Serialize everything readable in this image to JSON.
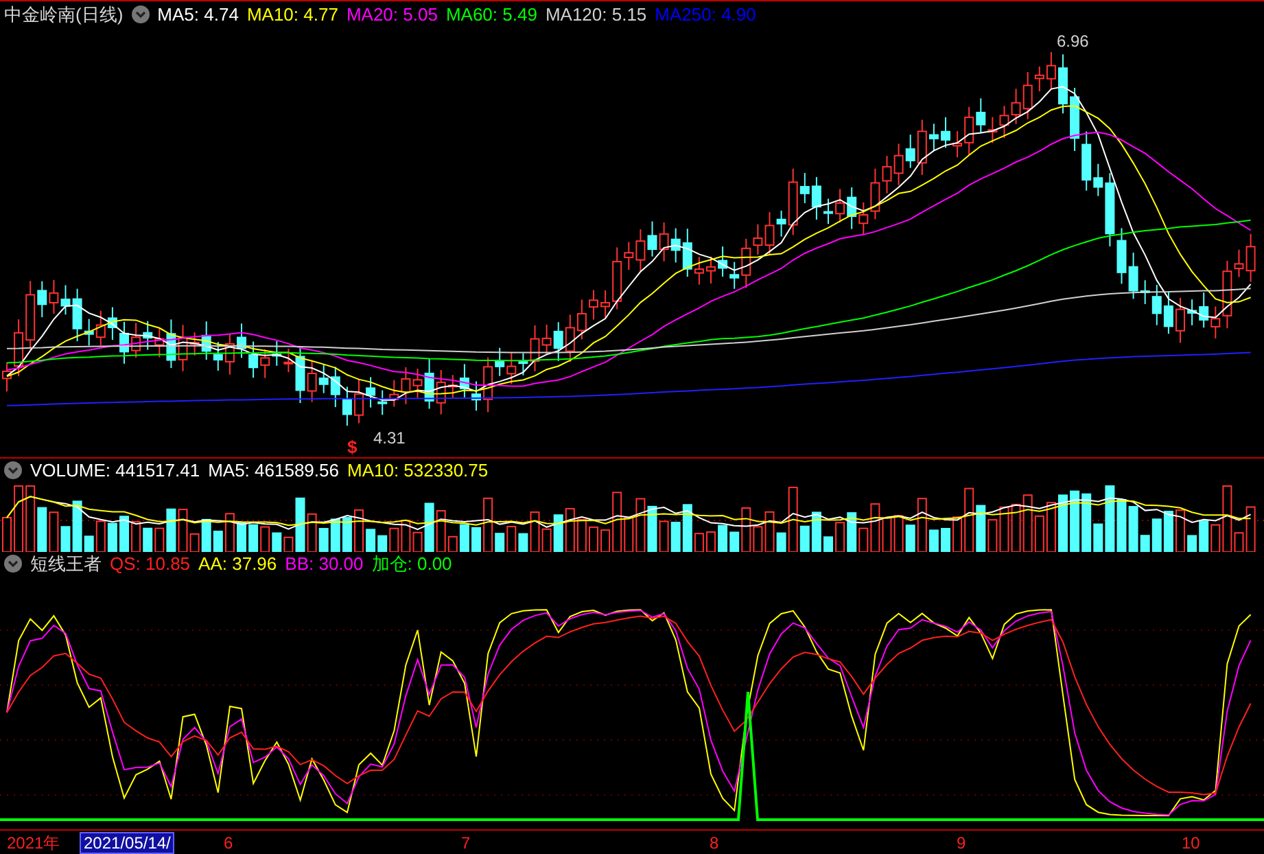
{
  "title": "中金岭南(日线)",
  "ma_legend": [
    {
      "label": "MA5: 4.74",
      "color": "#ffffff"
    },
    {
      "label": "MA10: 4.77",
      "color": "#ffff00"
    },
    {
      "label": "MA20: 5.05",
      "color": "#ff00ff"
    },
    {
      "label": "MA60: 5.49",
      "color": "#00ff00"
    },
    {
      "label": "MA120: 5.15",
      "color": "#d0d0d0"
    },
    {
      "label": "MA250: 4.90",
      "color": "#0000ff"
    }
  ],
  "price_chart": {
    "high_label": "6.96",
    "low_label": "4.31",
    "signal_mark": "$"
  },
  "volume_legend": [
    {
      "label": "VOLUME: 441517.41",
      "color": "#ffffff"
    },
    {
      "label": "MA5: 461589.56",
      "color": "#ffffff"
    },
    {
      "label": "MA10: 532330.75",
      "color": "#ffff00"
    }
  ],
  "indicator": {
    "name": "短线王者",
    "legend": [
      {
        "label": "QS: 10.85",
        "color": "#ff2020"
      },
      {
        "label": "AA: 37.96",
        "color": "#ffff00"
      },
      {
        "label": "BB: 30.00",
        "color": "#ff00ff"
      },
      {
        "label": "加仓: 0.00",
        "color": "#00ff00"
      }
    ]
  },
  "time_axis": [
    {
      "label": "2021年",
      "selected": false
    },
    {
      "label": "2021/05/14/",
      "selected": true
    },
    {
      "label": "6",
      "selected": false
    },
    {
      "label": "7",
      "selected": false
    },
    {
      "label": "8",
      "selected": false
    },
    {
      "label": "9",
      "selected": false
    },
    {
      "label": "10",
      "selected": false
    }
  ]
}
